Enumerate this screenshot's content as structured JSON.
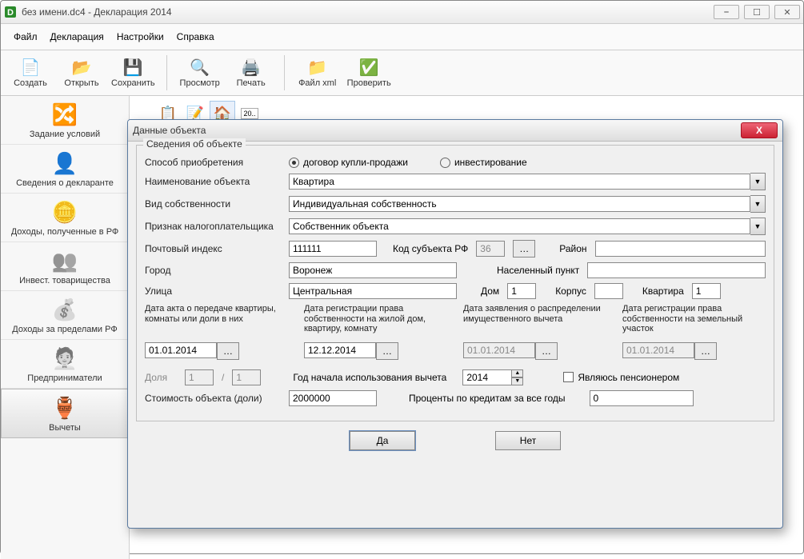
{
  "window": {
    "title": "без имени.dc4 - Декларация 2014"
  },
  "menu": {
    "file": "Файл",
    "decl": "Декларация",
    "settings": "Настройки",
    "help": "Справка"
  },
  "toolbar": {
    "create": "Создать",
    "open": "Открыть",
    "save": "Сохранить",
    "preview": "Просмотр",
    "print": "Печать",
    "xml": "Файл xml",
    "check": "Проверить"
  },
  "sidebar": {
    "items": [
      {
        "label": "Задание условий",
        "icon": "🔀"
      },
      {
        "label": "Сведения о декларанте",
        "icon": "👤"
      },
      {
        "label": "Доходы, полученные в РФ",
        "icon": "🪙"
      },
      {
        "label": "Инвест. товарищества",
        "icon": "👥"
      },
      {
        "label": "Доходы за пределами РФ",
        "icon": "💰"
      },
      {
        "label": "Предприниматели",
        "icon": "🧑‍💼"
      },
      {
        "label": "Вычеты",
        "icon": "🏺"
      }
    ],
    "selected": 6
  },
  "subtoolbar": {
    "doc_icon": "20.."
  },
  "dialog": {
    "title": "Данные объекта",
    "group": "Сведения об объекте",
    "labels": {
      "acq": "Способ приобретения",
      "acq_r1": "договор купли-продажи",
      "acq_r2": "инвестирование",
      "name": "Наименование объекта",
      "owntype": "Вид собственности",
      "taxpayer": "Признак налогоплательщика",
      "post": "Почтовый индекс",
      "region": "Код субъекта РФ",
      "district": "Район",
      "city": "Город",
      "settlement": "Населенный пункт",
      "street": "Улица",
      "house": "Дом",
      "building": "Корпус",
      "flat": "Квартира",
      "d1": "Дата акта о передаче квартиры, комнаты или доли в них",
      "d2": "Дата регистрации права собственности на жилой дом, квартиру, комнату",
      "d3": "Дата заявления о распределении имущественного вычета",
      "d4": "Дата регистрации права собственности на земельный участок",
      "share": "Доля",
      "year": "Год начала использования вычета",
      "pension": "Являюсь пенсионером",
      "cost": "Стоимость объекта (доли)",
      "interest": "Проценты по кредитам за все годы"
    },
    "values": {
      "name": "Квартира",
      "owntype": "Индивидуальная собственность",
      "taxpayer": "Собственник объекта",
      "post": "111111",
      "region": "36",
      "city": "Воронеж",
      "street": "Центральная",
      "house": "1",
      "flat": "1",
      "d1": "01.01.2014",
      "d2": "12.12.2014",
      "d3": "01.01.2014",
      "d4": "01.01.2014",
      "share1": "1",
      "share2": "1",
      "year": "2014",
      "cost": "2000000",
      "interest": "0"
    },
    "buttons": {
      "ok": "Да",
      "cancel": "Нет"
    }
  }
}
